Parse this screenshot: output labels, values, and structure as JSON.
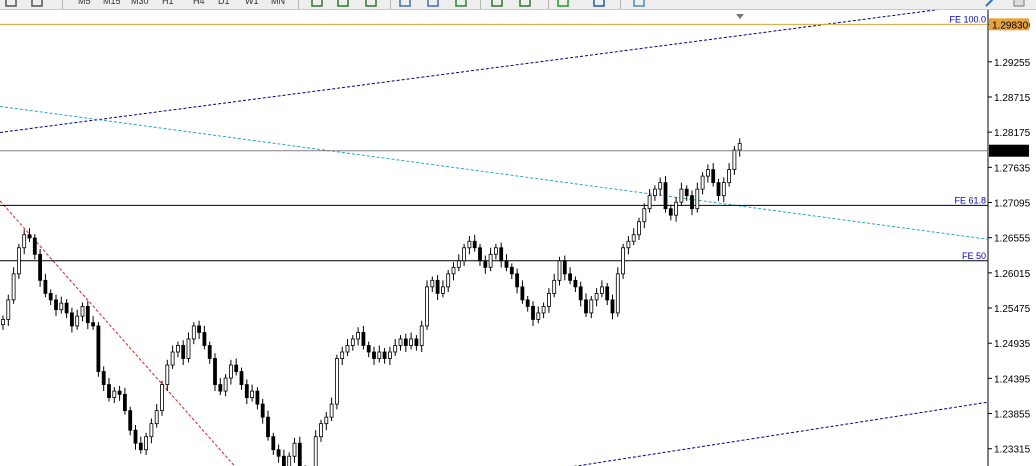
{
  "toolbar": {
    "timeframes": [
      "M5",
      "M15",
      "M30",
      "H1",
      "H4",
      "D1",
      "W1",
      "MN"
    ],
    "icons": [
      "objects-dropdown-icon",
      "line-studies-icon",
      "channel-icon",
      "fibo-icon",
      "zoom-in-icon",
      "zoom-out-icon",
      "tile-windows-icon",
      "period-separator-icon",
      "chart-shift-icon",
      "auto-scroll-icon",
      "add-indicator-icon",
      "history-icon",
      "templates-icon"
    ]
  },
  "chart_data": {
    "type": "candlestick",
    "symbol_hidden": true,
    "price_axis": {
      "ticks": [
        "1.29830",
        "1.29255",
        "1.28715",
        "1.28175",
        "1.27635",
        "1.27095",
        "1.26555",
        "1.26015",
        "1.25475",
        "1.24935",
        "1.24395",
        "1.23855",
        "1.23315"
      ],
      "range": [
        1.2305,
        1.3005
      ]
    },
    "current_price": "1.27890",
    "fibo_levels": [
      {
        "label": "FE 100.0",
        "price": 1.2983,
        "color": "#d9a63a"
      },
      {
        "label": "FE 61.8",
        "price": 1.2705,
        "color": "#000000"
      },
      {
        "label": "FE 50",
        "price": 1.262,
        "color": "#000000"
      }
    ],
    "colors": {
      "bull_candle": "#ffffff",
      "bear_candle": "#000000",
      "wick": "#000000",
      "price_line": "#808080",
      "channel_line": "#00008b",
      "cyan_trend": "#2aa6c2",
      "red_trend": "#e02020",
      "fe100_line": "#d9a63a",
      "axis_bg": "#ffffff",
      "current_price_bg": "#000000"
    },
    "trend_lines": [
      {
        "name": "upper-channel",
        "from_price": 1.2817,
        "to_price": 1.3008,
        "style": "dashed"
      },
      {
        "name": "lower-channel",
        "from_price": 1.2276,
        "to_price": 1.2403,
        "style": "dashed"
      },
      {
        "name": "cyan-trend",
        "from_price": 1.2857,
        "to_price": 1.2653,
        "style": "dashed"
      },
      {
        "name": "red-trend",
        "from_price": 1.2712,
        "to_price": 1.2299,
        "style": "dashed"
      }
    ],
    "closes": [
      1.253,
      1.256,
      1.26,
      1.264,
      1.266,
      1.2655,
      1.263,
      1.259,
      1.257,
      1.256,
      1.2545,
      1.2555,
      1.254,
      1.252,
      1.2535,
      1.255,
      1.2525,
      1.252,
      1.245,
      1.243,
      1.241,
      1.242,
      1.2415,
      1.239,
      1.236,
      1.234,
      1.233,
      1.235,
      1.237,
      1.239,
      1.243,
      1.246,
      1.248,
      1.249,
      1.247,
      1.25,
      1.252,
      1.251,
      1.249,
      1.247,
      1.243,
      1.242,
      1.244,
      1.246,
      1.245,
      1.243,
      1.241,
      1.242,
      1.24,
      1.238,
      1.235,
      1.233,
      1.232,
      1.23,
      1.232,
      1.234,
      1.23,
      1.229,
      1.228,
      1.235,
      1.237,
      1.238,
      1.24,
      1.247,
      1.248,
      1.249,
      1.25,
      1.251,
      1.249,
      1.248,
      1.247,
      1.248,
      1.247,
      1.248,
      1.249,
      1.25,
      1.249,
      1.25,
      1.249,
      1.252,
      1.258,
      1.259,
      1.257,
      1.258,
      1.26,
      1.261,
      1.262,
      1.264,
      1.265,
      1.264,
      1.262,
      1.261,
      1.263,
      1.264,
      1.262,
      1.261,
      1.26,
      1.258,
      1.256,
      1.255,
      1.253,
      1.254,
      1.255,
      1.257,
      1.259,
      1.262,
      1.26,
      1.259,
      1.258,
      1.256,
      1.254,
      1.256,
      1.257,
      1.258,
      1.256,
      1.254,
      1.26,
      1.264,
      1.265,
      1.266,
      1.268,
      1.27,
      1.272,
      1.273,
      1.274,
      1.27,
      1.269,
      1.271,
      1.273,
      1.272,
      1.27,
      1.273,
      1.275,
      1.276,
      1.274,
      1.272,
      1.274,
      1.276,
      1.279,
      1.28
    ]
  }
}
